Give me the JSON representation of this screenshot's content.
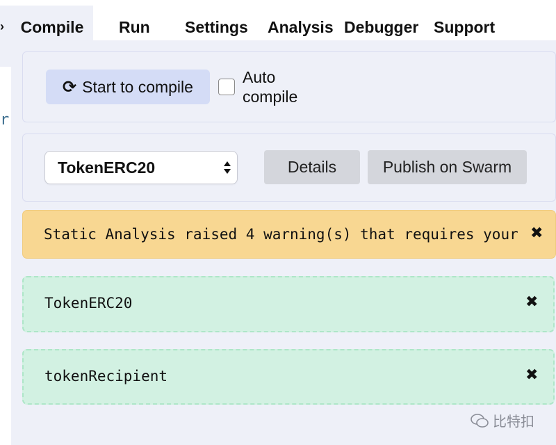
{
  "tabs": [
    {
      "label": "Compile",
      "active": true
    },
    {
      "label": "Run"
    },
    {
      "label": "Settings"
    },
    {
      "label": "Analysis"
    },
    {
      "label": "Debugger"
    },
    {
      "label": "Support"
    }
  ],
  "compile": {
    "button_label": "Start to compile",
    "auto_compile_label_1": "Auto",
    "auto_compile_label_2": "compile",
    "auto_compile_checked": false
  },
  "contract": {
    "selected": "TokenERC20",
    "details_label": "Details",
    "publish_label": "Publish on Swarm"
  },
  "alerts": [
    {
      "type": "warning",
      "text": "Static Analysis raised 4 warning(s) that requires your"
    },
    {
      "type": "success",
      "text": "TokenERC20"
    },
    {
      "type": "success",
      "text": "tokenRecipient"
    }
  ],
  "editor": {
    "fragment": "r"
  },
  "watermark": {
    "text": "比特扣"
  },
  "colors": {
    "panel_bg": "#eef0f8",
    "warning_bg": "#f8d792",
    "success_bg": "#d2f1e2",
    "primary_btn": "#d4dcf6",
    "secondary_btn": "#d4d6dc"
  }
}
